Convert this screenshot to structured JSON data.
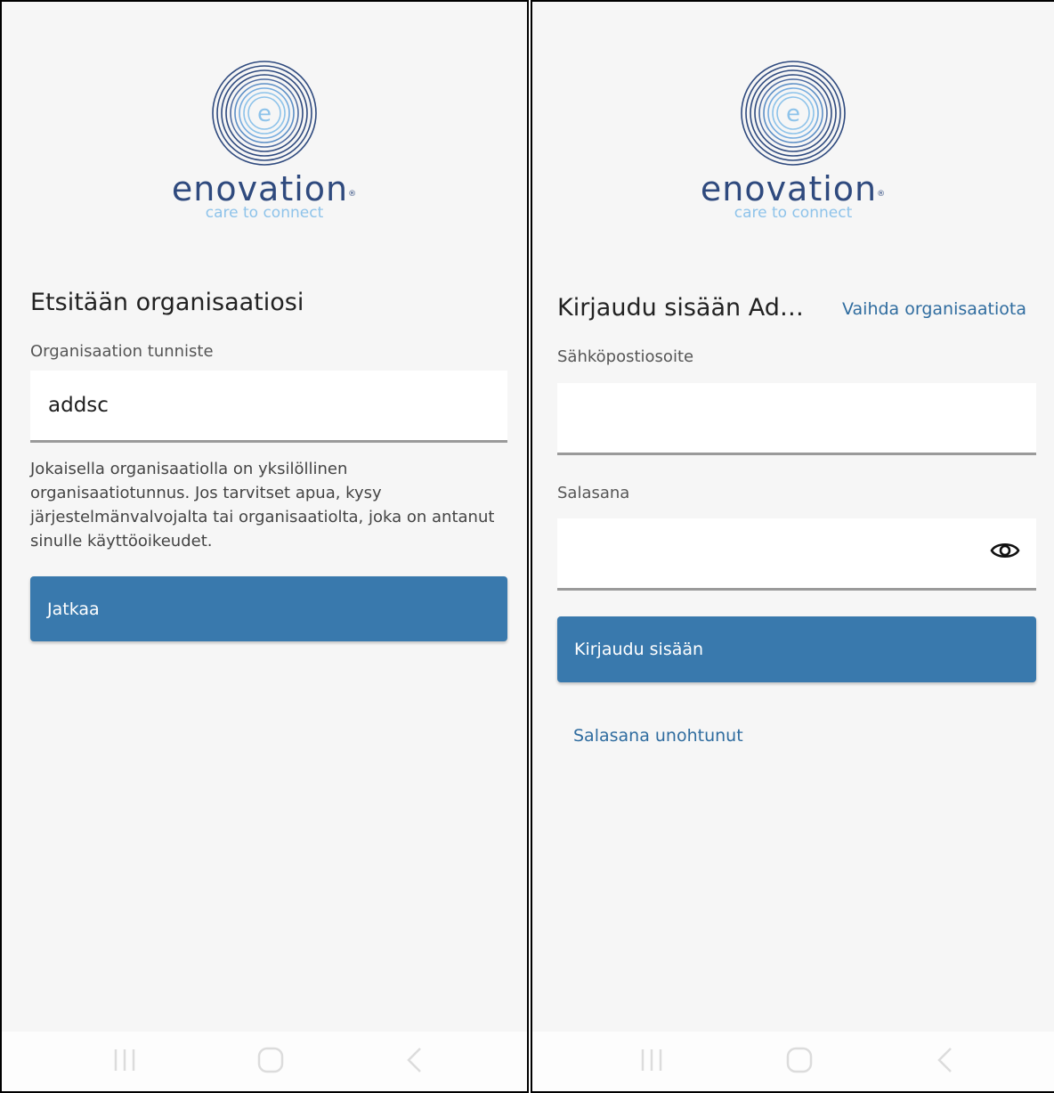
{
  "left": {
    "logo": {
      "wordmark": "enovation",
      "registered": "®",
      "tagline": "care to connect"
    },
    "heading": "Etsitään organisaatiosi",
    "org_label": "Organisaation tunniste",
    "org_value": "addsc",
    "help_text": "Jokaisella organisaatiolla on yksilöllinen organisaatiotunnus. Jos tarvitset apua, kysy järjestelmänvalvojalta tai organisaatiolta, joka on antanut sinulle käyttöoikeudet.",
    "continue_label": "Jatkaa",
    "nav": [
      "recent-apps-icon",
      "home-icon",
      "back-icon"
    ]
  },
  "right": {
    "logo": {
      "wordmark": "enovation",
      "registered": "®",
      "tagline": "care to connect"
    },
    "heading": "Kirjaudu sisään Ad…",
    "change_org_link": "Vaihda organisaatiota",
    "email_label": "Sähköpostiosoite",
    "email_value": "",
    "password_label": "Salasana",
    "password_value": "",
    "signin_label": "Kirjaudu sisään",
    "forgot_link": "Salasana unohtunut",
    "nav": [
      "recent-apps-icon",
      "home-icon",
      "back-icon"
    ]
  },
  "colors": {
    "primary": "#3979ad",
    "logo_dark": "#2f4a7e",
    "logo_light": "#8ec3ea",
    "background": "#f6f6f6"
  }
}
